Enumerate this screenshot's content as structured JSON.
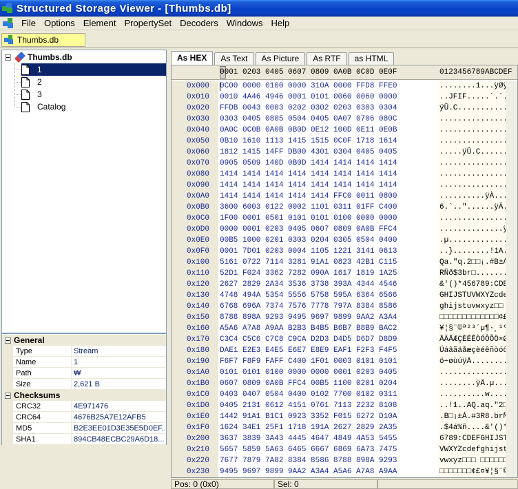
{
  "window": {
    "title": "Structured Storage Viewer - [Thumbs.db]"
  },
  "menu": [
    "File",
    "Options",
    "Element",
    "PropertySet",
    "Decoders",
    "Windows",
    "Help"
  ],
  "document_tab": {
    "label": "Thumbs.db"
  },
  "tree": {
    "root": "Thumbs.db",
    "items": [
      "1",
      "2",
      "3",
      "Catalog"
    ],
    "selected_index": 0
  },
  "properties": {
    "general": {
      "header": "General",
      "rows": [
        {
          "name": "Type",
          "value": "Stream"
        },
        {
          "name": "Name",
          "value": "1"
        },
        {
          "name": "Path",
          "value": "₩"
        },
        {
          "name": "Size",
          "value": "2,621 B"
        }
      ]
    },
    "checksums": {
      "header": "Checksums",
      "rows": [
        {
          "name": "CRC32",
          "value": "4E971476"
        },
        {
          "name": "CRC64",
          "value": "4676B25A7E12AFB5"
        },
        {
          "name": "MD5",
          "value": "B2E3EE01D3E35E5D0EF..."
        },
        {
          "name": "SHA1",
          "value": "894CB48ECBC29A6D18..."
        }
      ]
    }
  },
  "view_tabs": [
    "As HEX",
    "As Text",
    "As Picture",
    "As RTF",
    "as HTML"
  ],
  "active_view_tab": 0,
  "hex": {
    "header_hex": "0001 0203 0405 0607 0809 0A0B 0C0D 0E0F",
    "header_ascii": "0123456789ABCDEF",
    "rows": [
      {
        "off": "0x000",
        "hex": "0C00 0000 0100 0000 310A 0000 FFD8 FFE0",
        "asc": "........1...ÿØÿà"
      },
      {
        "off": "0x010",
        "hex": "0010 4A46 4946 0001 0101 0060 0060 0000",
        "asc": "..JFIF.....`.`.."
      },
      {
        "off": "0x020",
        "hex": "FFDB 0043 0003 0202 0302 0203 0303 0304",
        "asc": "ÿÛ.C............"
      },
      {
        "off": "0x030",
        "hex": "0303 0405 0805 0504 0405 0A07 0706 080C",
        "asc": "................"
      },
      {
        "off": "0x040",
        "hex": "0A0C 0C0B 0A0B 0B0D 0E12 100D 0E11 0E0B",
        "asc": "................"
      },
      {
        "off": "0x050",
        "hex": "0B10 1610 1113 1415 1515 0C0F 1718 1614",
        "asc": "................"
      },
      {
        "off": "0x060",
        "hex": "1812 1415 14FF DB00 4301 0304 0405 0405",
        "asc": ".....ÿÛ.C......."
      },
      {
        "off": "0x070",
        "hex": "0905 0509 140D 0B0D 1414 1414 1414 1414",
        "asc": "................"
      },
      {
        "off": "0x080",
        "hex": "1414 1414 1414 1414 1414 1414 1414 1414",
        "asc": "................"
      },
      {
        "off": "0x090",
        "hex": "1414 1414 1414 1414 1414 1414 1414 1414",
        "asc": "................"
      },
      {
        "off": "0x0A0",
        "hex": "1414 1414 1414 1414 1414 FFC0 0011 0800",
        "asc": "..........ÿÀ...."
      },
      {
        "off": "0x0B0",
        "hex": "3600 6003 0122 0002 1101 0311 01FF C400",
        "asc": "6.`..\"......ÿÄ."
      },
      {
        "off": "0x0C0",
        "hex": "1F00 0001 0501 0101 0101 0100 0000 0000",
        "asc": "................"
      },
      {
        "off": "0x0D0",
        "hex": "0000 0001 0203 0405 0607 0809 0A0B FFC4",
        "asc": "..............ÿÄ"
      },
      {
        "off": "0x0E0",
        "hex": "00B5 1000 0201 0303 0204 0305 0504 0400",
        "asc": ".µ.............."
      },
      {
        "off": "0x0F0",
        "hex": "0001 7D01 0203 0004 1105 1221 3141 0613",
        "asc": "..}........!1A.."
      },
      {
        "off": "0x100",
        "hex": "5161 0722 7114 3281 91A1 0823 42B1 C115",
        "asc": "Qa.\"q.2□□¡.#B±Á."
      },
      {
        "off": "0x110",
        "hex": "52D1 F024 3362 7282 090A 1617 1819 1A25",
        "asc": "RÑð$3br□.......%"
      },
      {
        "off": "0x120",
        "hex": "2627 2829 2A34 3536 3738 393A 4344 4546",
        "asc": "&'()*456789:CDEF"
      },
      {
        "off": "0x130",
        "hex": "4748 494A 5354 5556 5758 595A 6364 6566",
        "asc": "GHIJSTUVWXYZcdef"
      },
      {
        "off": "0x140",
        "hex": "6768 696A 7374 7576 7778 797A 8384 8586",
        "asc": "ghijstuvwxyz□□ □"
      },
      {
        "off": "0x150",
        "hex": "8788 898A 9293 9495 9697 9899 9AA2 A3A4",
        "asc": "□□□□□□□□□□□□□¢£¤"
      },
      {
        "off": "0x160",
        "hex": "A5A6 A7A8 A9AA B2B3 B4B5 B6B7 B8B9 BAC2",
        "asc": "¥¦§¨©ª²³´µ¶·¸¹ºÂ"
      },
      {
        "off": "0x170",
        "hex": "C3C4 C5C6 C7C8 C9CA D2D3 D4D5 D6D7 D8D9",
        "asc": "ÃÄÅÆÇÈÉÊÒÓÔÕÖ×ØÙ"
      },
      {
        "off": "0x180",
        "hex": "DAE1 E2E3 E4E5 E6E7 E8E9 EAF1 F2F3 F4F5",
        "asc": "Úáâãäåæçèéêñòóôõ"
      },
      {
        "off": "0x190",
        "hex": "F6F7 F8F9 FAFF C400 1F01 0003 0101 0101",
        "asc": "ö÷øùúÿÄ........."
      },
      {
        "off": "0x1A0",
        "hex": "0101 0101 0100 0000 0000 0001 0203 0405",
        "asc": "................"
      },
      {
        "off": "0x1B0",
        "hex": "0607 0809 0A0B FFC4 00B5 1100 0201 0204",
        "asc": "........ÿÄ.µ...."
      },
      {
        "off": "0x1C0",
        "hex": "0403 0407 0504 0400 0102 7700 0102 0311",
        "asc": "..........w....."
      },
      {
        "off": "0x1D0",
        "hex": "0405 2131 0612 4151 0761 7113 2232 8108",
        "asc": "..!1..AQ.aq.\"2□."
      },
      {
        "off": "0x1E0",
        "hex": "1442 91A1 B1C1 0923 3352 F015 6272 D10A",
        "asc": ".B□¡±Á.#3R8.brÑ."
      },
      {
        "off": "0x1F0",
        "hex": "1624 34E1 25F1 1718 191A 2627 2829 2A35",
        "asc": ".$4á%ñ....&'()*5"
      },
      {
        "off": "0x200",
        "hex": "3637 3839 3A43 4445 4647 4849 4A53 5455",
        "asc": "6789:CDEFGHIJSTU"
      },
      {
        "off": "0x210",
        "hex": "5657 5859 5A63 6465 6667 6869 6A73 7475",
        "asc": "VWXYZcdefghijstu"
      },
      {
        "off": "0x220",
        "hex": "7677 7879 7A82 8384 8586 8788 898A 9293",
        "asc": "vwxyz□□□ □□□□□□□"
      },
      {
        "off": "0x230",
        "hex": "9495 9697 9899 9AA2 A3A4 A5A6 A7A8 A9AA",
        "asc": "□□□□□□□¢£¤¥¦§¨©ª"
      }
    ]
  },
  "status": {
    "pos": "Pos: 0 (0x0)",
    "sel": "Sel: 0"
  }
}
